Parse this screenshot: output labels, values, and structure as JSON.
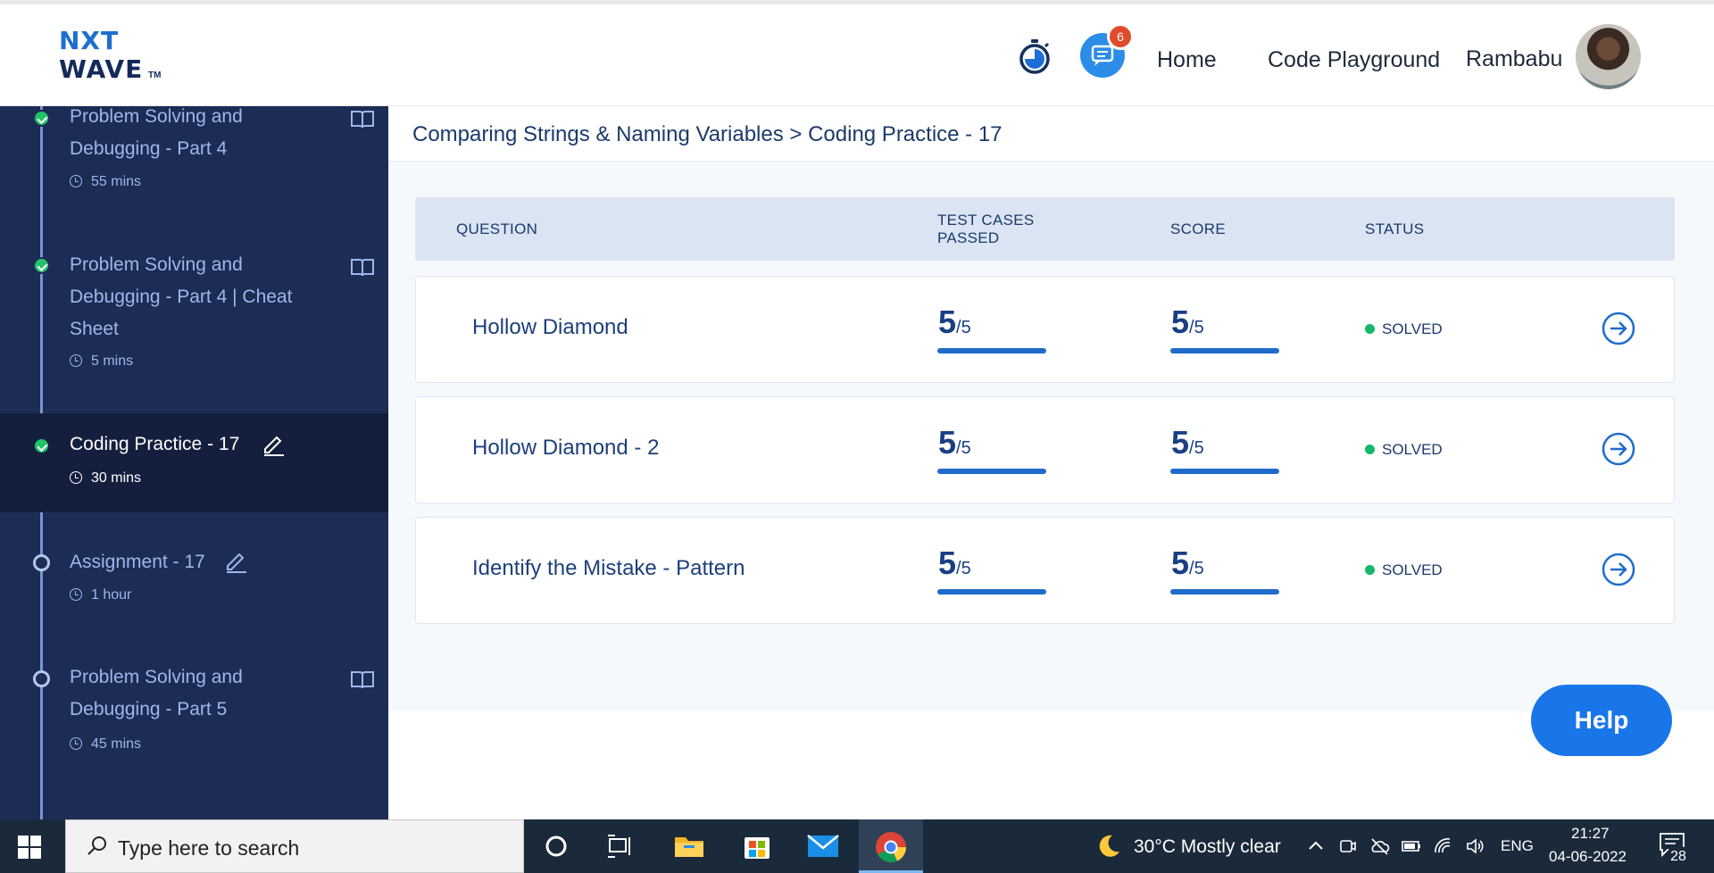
{
  "header": {
    "logo_line1": "NXT",
    "logo_line2": "WAVE",
    "logo_tm": "TM",
    "notification_count": "6",
    "nav": {
      "home": "Home",
      "playground": "Code Playground",
      "user": "Rambabu"
    }
  },
  "sidebar": {
    "items": [
      {
        "title": "Problem Solving and Debugging - Part 4",
        "time": "55 mins",
        "status": "done",
        "icon": "book-icon"
      },
      {
        "title": "Problem Solving and Debugging - Part 4 | Cheat Sheet",
        "time": "5 mins",
        "status": "done",
        "icon": "book-icon"
      },
      {
        "title": "Coding Practice - 17",
        "time": "30 mins",
        "status": "done",
        "icon": "pencil-icon",
        "active": true
      },
      {
        "title": "Assignment - 17",
        "time": "1 hour",
        "status": "open",
        "icon": "pencil-icon"
      },
      {
        "title": "Problem Solving and Debugging - Part 5",
        "time": "45 mins",
        "status": "open",
        "icon": "book-icon"
      }
    ]
  },
  "main": {
    "breadcrumb": "Comparing Strings & Naming Variables > Coding Practice - 17",
    "columns": {
      "question": "QUESTION",
      "tests_line1": "TEST CASES",
      "tests_line2": "PASSED",
      "score": "SCORE",
      "status": "STATUS"
    },
    "rows": [
      {
        "name": "Hollow Diamond",
        "tests_passed": "5",
        "tests_total": "/5",
        "tests_fraction": 1.0,
        "score": "5",
        "score_total": "/5",
        "score_fraction": 1.0,
        "status": "SOLVED"
      },
      {
        "name": "Hollow Diamond - 2",
        "tests_passed": "5",
        "tests_total": "/5",
        "tests_fraction": 1.0,
        "score": "5",
        "score_total": "/5",
        "score_fraction": 1.0,
        "status": "SOLVED"
      },
      {
        "name": "Identify the Mistake - Pattern",
        "tests_passed": "5",
        "tests_total": "/5",
        "tests_fraction": 1.0,
        "score": "5",
        "score_total": "/5",
        "score_fraction": 1.0,
        "status": "SOLVED"
      }
    ],
    "help_label": "Help"
  },
  "taskbar": {
    "search_placeholder": "Type here to search",
    "weather": "30°C  Mostly clear",
    "language": "ENG",
    "time": "21:27",
    "date": "04-06-2022",
    "notifications": "28"
  },
  "colors": {
    "accent": "#1976e8",
    "sidebar": "#1d2c54",
    "solved": "#15b86b",
    "badge": "#e04b2b"
  }
}
